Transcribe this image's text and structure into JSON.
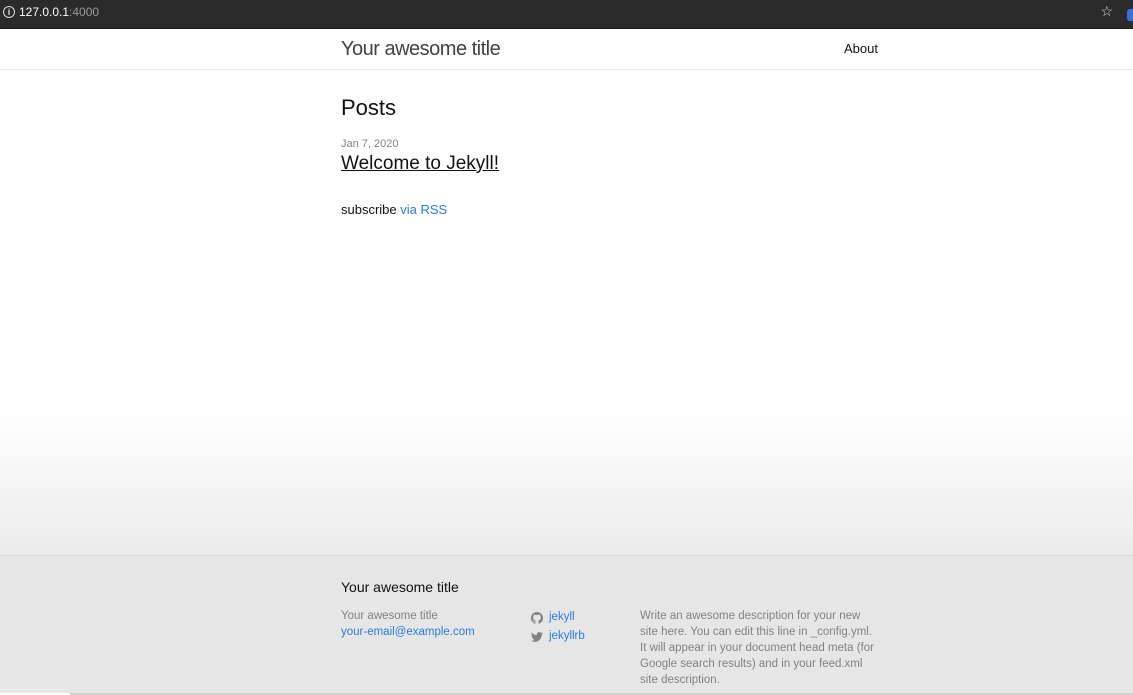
{
  "browser": {
    "url_host": "127.0.0.1",
    "url_port": ":4000",
    "info_icon": "info-icon",
    "bookmark_icon": "star-icon"
  },
  "header": {
    "site_title": "Your awesome title",
    "nav": [
      {
        "label": "About"
      }
    ]
  },
  "main": {
    "heading": "Posts",
    "posts": [
      {
        "date": "Jan 7, 2020",
        "title": "Welcome to Jekyll!"
      }
    ],
    "rss_prefix": "subscribe ",
    "rss_link": "via RSS"
  },
  "footer": {
    "heading": "Your awesome title",
    "col1": {
      "name": "Your awesome title",
      "email": "your-email@example.com"
    },
    "social": [
      {
        "icon": "github-icon",
        "label": "jekyll"
      },
      {
        "icon": "twitter-icon",
        "label": "jekyllrb"
      }
    ],
    "description": "Write an awesome description for your new site here. You can edit this line in _config.yml. It will appear in your document head meta (for Google search results) and in your feed.xml site description."
  },
  "colors": {
    "link": "#2a7ae2",
    "meta": "#828282",
    "chrome": "#2b2b2b"
  }
}
